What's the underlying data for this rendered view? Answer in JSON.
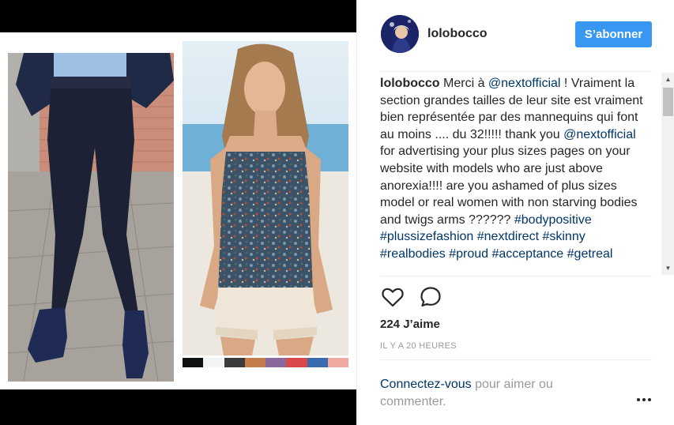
{
  "post": {
    "username": "lolobocco",
    "follow_label": "S’abonner",
    "comment": {
      "author": "lolobocco",
      "segments": [
        {
          "text": " Merci à ",
          "tag": false
        },
        {
          "text": "@nextofficial",
          "tag": true
        },
        {
          "text": " ! Vraiment la section grandes tailles de leur site est vraiment bien représentée par des mannequins qui font au moins .... du 32!!!!! thank you ",
          "tag": false
        },
        {
          "text": "@nextofficial",
          "tag": true
        },
        {
          "text": " for advertising your plus sizes pages on your website with models who are just above anorexia!!!! are you ashamed of plus sizes model or real women with non starving bodies and twigs arms ?????? ",
          "tag": false
        },
        {
          "text": "#bodypositive",
          "tag": true
        },
        {
          "text": " ",
          "tag": false
        },
        {
          "text": "#plussizefashion",
          "tag": true
        },
        {
          "text": " ",
          "tag": false
        },
        {
          "text": "#nextdirect",
          "tag": true
        },
        {
          "text": " ",
          "tag": false
        },
        {
          "text": "#skinny",
          "tag": true
        },
        {
          "text": " ",
          "tag": false
        },
        {
          "text": "#realbodies",
          "tag": true
        },
        {
          "text": " ",
          "tag": false
        },
        {
          "text": "#proud",
          "tag": true
        },
        {
          "text": " ",
          "tag": false
        },
        {
          "text": "#acceptance",
          "tag": true
        },
        {
          "text": " ",
          "tag": false
        },
        {
          "text": "#getreal",
          "tag": true
        }
      ]
    },
    "likes_label": "224 J’aime",
    "timestamp": "IL Y A 20 HEURES",
    "login_link": "Connectez-vous",
    "login_rest": " pour aimer ou commenter.",
    "icons": {
      "like": "heart-icon",
      "comment": "comment-bubble-icon",
      "more": "more-options-icon"
    },
    "colors": {
      "follow_button": "#3897f0",
      "link": "#003569",
      "muted": "#999999",
      "text": "#262626"
    }
  }
}
